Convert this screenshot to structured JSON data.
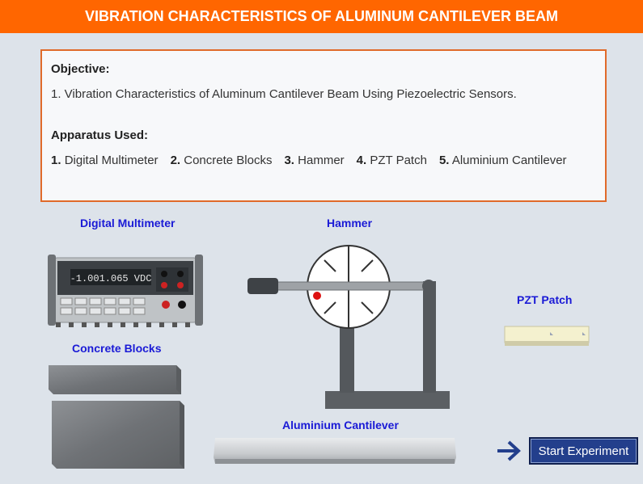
{
  "header": {
    "title": "VIBRATION CHARACTERISTICS OF ALUMINUM CANTILEVER BEAM"
  },
  "objective": {
    "heading": "Objective:",
    "text": "1. Vibration Characteristics of Aluminum Cantilever Beam Using Piezoelectric Sensors."
  },
  "apparatus": {
    "heading": "Apparatus Used:",
    "items": [
      {
        "num": "1.",
        "name": "Digital Multimeter"
      },
      {
        "num": "2.",
        "name": "Concrete Blocks"
      },
      {
        "num": "3.",
        "name": "Hammer"
      },
      {
        "num": "4.",
        "name": "PZT Patch"
      },
      {
        "num": "5.",
        "name": "Aluminium Cantilever"
      }
    ]
  },
  "labels": {
    "multimeter": "Digital Multimeter",
    "hammer": "Hammer",
    "pzt": "PZT Patch",
    "concrete": "Concrete Blocks",
    "cantilever": "Aluminium Cantilever"
  },
  "multimeter_display": "-1.001.065 VDC",
  "start_button": "Start Experiment",
  "colors": {
    "header": "#ff6600",
    "label": "#1a1ad6",
    "button": "#233f8c",
    "border": "#e06a2a"
  }
}
